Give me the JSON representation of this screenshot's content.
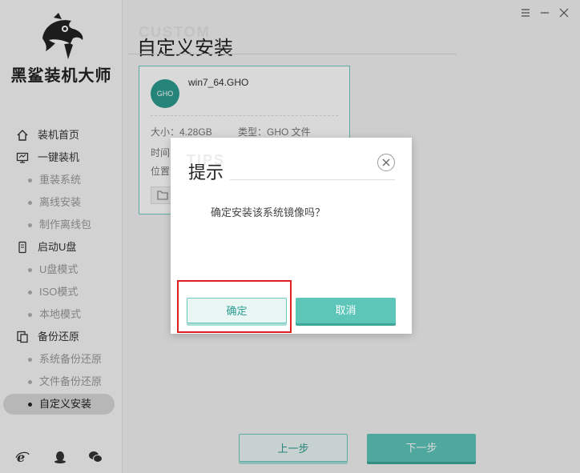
{
  "app": {
    "brand": "黑鲨装机大师"
  },
  "sidebar": {
    "items": [
      {
        "label": "装机首页",
        "icon": "home-icon"
      },
      {
        "label": "一键装机",
        "icon": "monitor-icon"
      },
      {
        "label": "重装系统"
      },
      {
        "label": "离线安装"
      },
      {
        "label": "制作离线包"
      },
      {
        "label": "启动U盘",
        "icon": "usb-icon"
      },
      {
        "label": "U盘模式"
      },
      {
        "label": "ISO模式"
      },
      {
        "label": "本地模式"
      },
      {
        "label": "备份还原",
        "icon": "backup-icon"
      },
      {
        "label": "系统备份还原"
      },
      {
        "label": "文件备份还原"
      },
      {
        "label": "自定义安装",
        "active": true
      }
    ],
    "footer_icons": [
      "ie-icon",
      "qq-icon",
      "wechat-icon"
    ]
  },
  "main": {
    "watermark": "CUSTOM",
    "title": "自定义安装",
    "file": {
      "name": "win7_64.GHO",
      "badge": "GHO",
      "size": "大小：4.28GB",
      "type": "类型：GHO 文件",
      "time_label": "时间",
      "location_label": "位置"
    },
    "prev_label": "上一步",
    "next_label": "下一步"
  },
  "dialog": {
    "watermark": "TIPS",
    "title": "提示",
    "message": "确定安装该系统镜像吗？",
    "ok_label": "确定",
    "cancel_label": "取消"
  },
  "colors": {
    "accent": "#5dc6b9",
    "accent_dark": "#2c9c90",
    "highlight": "#e02020"
  }
}
